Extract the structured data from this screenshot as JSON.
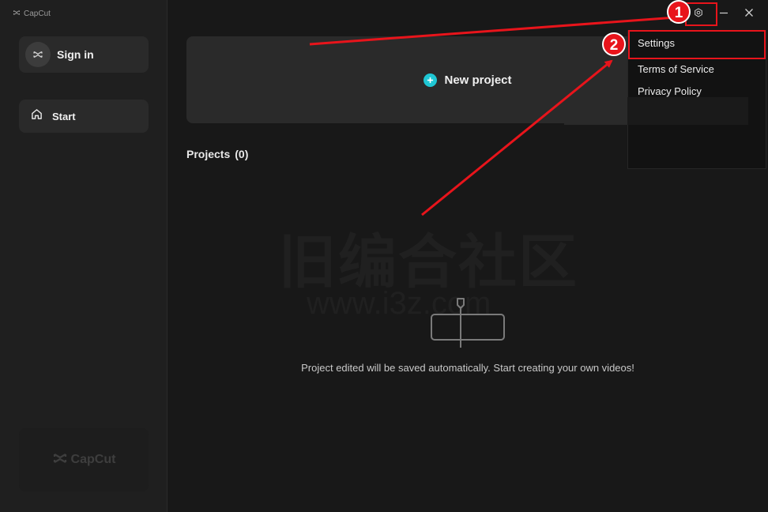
{
  "app": {
    "title": "CapCut"
  },
  "sidebar": {
    "sign_in_label": "Sign in",
    "start_label": "Start",
    "logo_text": "CapCut"
  },
  "main": {
    "new_project_label": "New project",
    "projects_label": "Projects",
    "projects_count": "(0)",
    "empty_message": "Project edited will be saved automatically. Start creating your own videos!"
  },
  "menu": {
    "items": [
      {
        "label": "Settings"
      },
      {
        "label": "Terms of Service"
      },
      {
        "label": "Privacy Policy"
      }
    ]
  },
  "annotations": {
    "badges": [
      "1",
      "2"
    ],
    "color": "#e8141b"
  },
  "watermark": {
    "text_cn": "旧编合社区",
    "text_url": "www.i3z.com"
  },
  "colors": {
    "accent": "#1fc7d4",
    "background": "#181818",
    "sidebar": "#1f1f1f",
    "card": "#2a2a2a"
  }
}
